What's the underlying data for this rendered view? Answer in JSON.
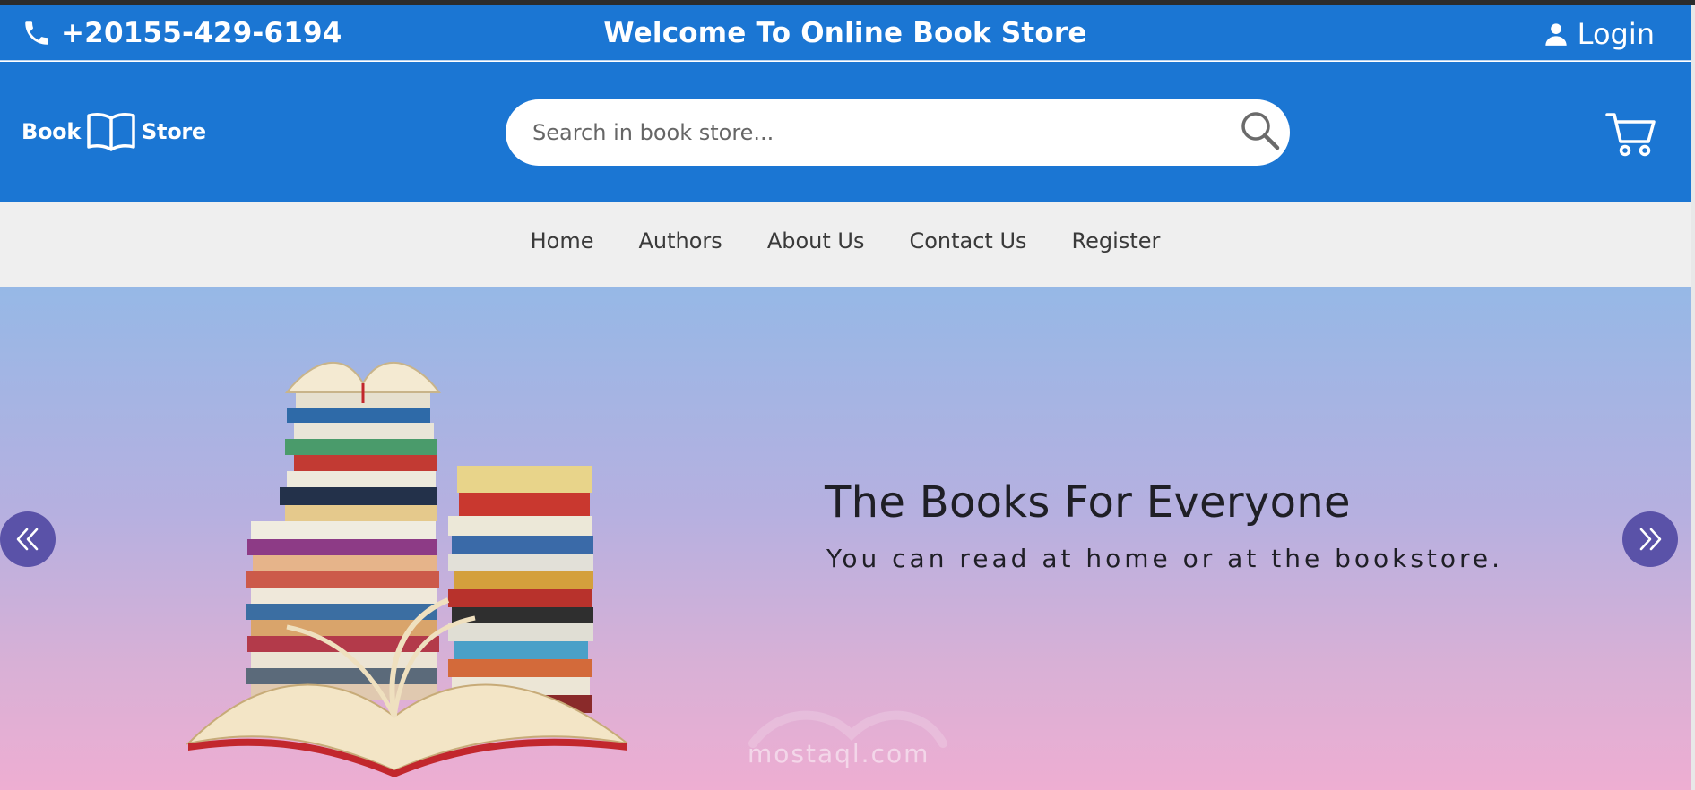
{
  "topbar": {
    "phone": "+20155-429-6194",
    "welcome": "Welcome To Online Book Store",
    "login_label": "Login",
    "phone_icon": "phone-icon",
    "user_icon": "user-icon"
  },
  "header": {
    "logo_left": "Book",
    "logo_right": "Store",
    "logo_icon": "open-book-icon",
    "search_placeholder": "Search in book store...",
    "search_icon": "search-icon",
    "cart_icon": "cart-icon"
  },
  "nav": {
    "items": [
      "Home",
      "Authors",
      "About Us",
      "Contact Us",
      "Register"
    ]
  },
  "hero": {
    "title": "The Books For Everyone",
    "subtitle": "You can read at home or at the bookstore.",
    "prev_icon": "chevrons-left-icon",
    "next_icon": "chevrons-right-icon",
    "watermark": "mostaql.com"
  },
  "colors": {
    "brand_blue": "#1b76d3",
    "nav_bg": "#efefef",
    "arrow_bg": "#5a52a8",
    "hero_top": "#96b8e6",
    "hero_bottom": "#eeaed2"
  }
}
